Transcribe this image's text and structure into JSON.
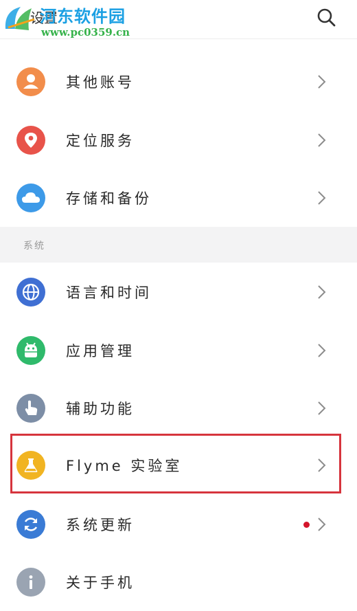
{
  "header": {
    "title": "设置",
    "search_icon": "search-icon"
  },
  "watermark": {
    "site_name": "河东软件园",
    "url": "www.pc0359.cn"
  },
  "account_section": {
    "items": [
      {
        "label": "其他账号",
        "icon": "person-icon",
        "color": "#f28d4b"
      },
      {
        "label": "定位服务",
        "icon": "location-pin-icon",
        "color": "#e8534a"
      },
      {
        "label": "存储和备份",
        "icon": "cloud-icon",
        "color": "#3d9ae8"
      }
    ]
  },
  "system_section": {
    "header": "系统",
    "items": [
      {
        "label": "语言和时间",
        "icon": "globe-icon",
        "color": "#3f6fd3"
      },
      {
        "label": "应用管理",
        "icon": "android-icon",
        "color": "#2fba6b"
      },
      {
        "label": "辅助功能",
        "icon": "hand-pointer-icon",
        "color": "#7d8ea6"
      },
      {
        "label": "Flyme 实验室",
        "icon": "flask-icon",
        "color": "#f1b422",
        "highlighted": true
      },
      {
        "label": "系统更新",
        "icon": "refresh-icon",
        "color": "#3a7bd5",
        "badge": "red-dot"
      },
      {
        "label": "关于手机",
        "icon": "info-icon",
        "color": "#9aa4b2"
      }
    ]
  }
}
